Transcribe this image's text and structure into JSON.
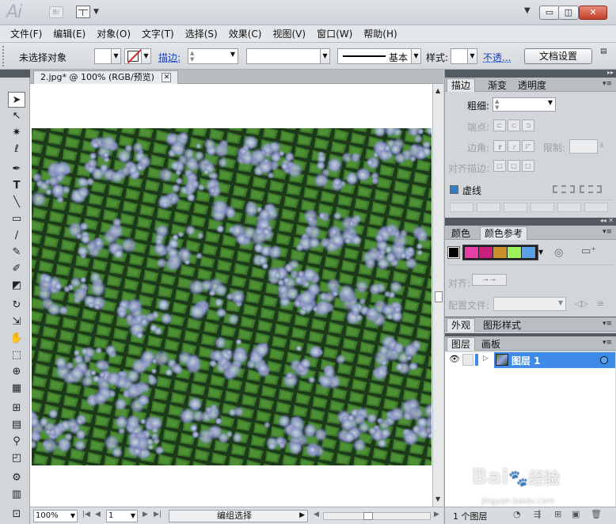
{
  "titlebar": {
    "logo": "Ai",
    "bridge": "Br",
    "minimize": "▭",
    "maximize": "◫",
    "close": "✕"
  },
  "menu": [
    "文件(F)",
    "编辑(E)",
    "对象(O)",
    "文字(T)",
    "选择(S)",
    "效果(C)",
    "视图(V)",
    "窗口(W)",
    "帮助(H)"
  ],
  "control": {
    "selection_status": "未选择对象",
    "stroke_label": "描边:",
    "brush_label": "基本",
    "style_label": "样式:",
    "opacity_label": "不透...",
    "doc_settings": "文档设置"
  },
  "document": {
    "tab_title": "2.jpg* @ 100% (RGB/预览)",
    "close": "✕"
  },
  "status": {
    "zoom": "100%",
    "artboard": "1",
    "status_text": "编组选择"
  },
  "stroke_panel": {
    "tabs": [
      "描边",
      "渐变",
      "透明度"
    ],
    "weight_label": "粗细:",
    "cap_label": "端点:",
    "corner_label": "边角:",
    "limit_label": "限制:",
    "limit_unit": "x",
    "align_label": "对齐描边:",
    "dashed_label": "虚线"
  },
  "color_panel": {
    "tabs": [
      "颜色",
      "颜色参考"
    ],
    "swatches": [
      "#e83fa4",
      "#c81f7c",
      "#c9902b",
      "#9cf05a",
      "#5aa1e6"
    ],
    "align_label": "对齐:",
    "profile_label": "配置文件:"
  },
  "appearance_panel": {
    "tabs": [
      "外观",
      "图形样式"
    ]
  },
  "layers_panel": {
    "tabs": [
      "图层",
      "画板"
    ],
    "layer_name": "图层 1",
    "count_label": "1 个图层",
    "highlight_color": "#3d8be6"
  },
  "watermark": {
    "brand": "Bai",
    "sub": "经验",
    "url": "jingyan.baidu.com"
  }
}
